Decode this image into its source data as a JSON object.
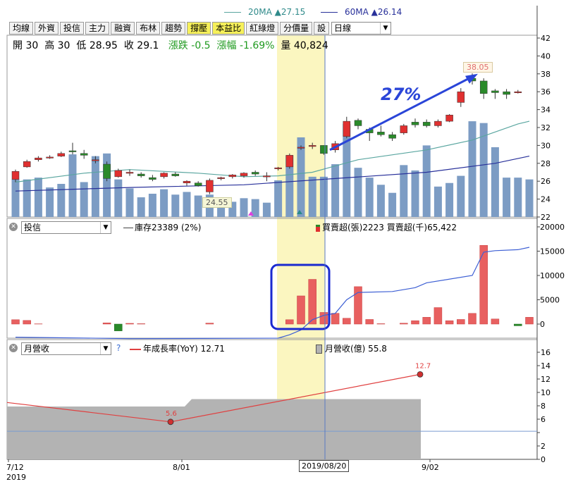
{
  "legend_top": {
    "ma20": "20MA ▲27.15",
    "ma60": "60MA ▲26.14"
  },
  "toolbar": {
    "buttons": [
      "均線",
      "外資",
      "投信",
      "主力",
      "融資",
      "布林",
      "趨勢",
      "撐壓",
      "本益比",
      "紅綠燈",
      "分價量",
      "設"
    ],
    "highlighted": [
      "撐壓",
      "本益比"
    ],
    "period": "日線"
  },
  "quote": {
    "open_label": "開",
    "open": "30",
    "high_label": "高",
    "high": "30",
    "low_label": "低",
    "low": "28.95",
    "close_label": "收",
    "close": "29.1",
    "chg_label": "漲跌",
    "chg": "-0.5",
    "pct_label": "漲幅",
    "pct": "-1.69%",
    "vol_label": "量",
    "vol": "40,824"
  },
  "annotations": {
    "pct": "27%",
    "high_label": "38.05",
    "low_label": "24.55",
    "date_marker": "2019/08/20"
  },
  "panel2": {
    "selector": "投信",
    "legend_inventory": "庫存23389 (2%)",
    "legend_net": "買賣超(張)2223 買賣超(千)65,422"
  },
  "panel3": {
    "selector": "月營收",
    "help": "?",
    "legend_yoy": "年成長率(YoY) 12.71",
    "legend_rev": "月營收(億) 55.8"
  },
  "x_axis": {
    "labels": [
      "7/12",
      "8/01",
      "9/02"
    ],
    "year": "2019"
  },
  "colors": {
    "up": "#e03030",
    "down": "#2a8a2a",
    "vol": "#7c9cc4",
    "ma20": "#5aa6a0",
    "ma60": "#28309a",
    "netbar": "#e86060",
    "inventory": "#3d5fd4",
    "yoy": "#e04040",
    "rev": "#b3b3b3",
    "highlight": "#fbf6c0"
  },
  "chart_data": [
    {
      "type": "candlestick",
      "title": "",
      "ylim": [
        22,
        42
      ],
      "yticks": [
        22,
        24,
        26,
        28,
        30,
        32,
        34,
        36,
        38,
        40,
        42
      ],
      "candles": [
        {
          "o": 26.2,
          "h": 27.3,
          "l": 25.9,
          "c": 27.1
        },
        {
          "o": 27.6,
          "h": 28.4,
          "l": 27.5,
          "c": 28.2
        },
        {
          "o": 28.4,
          "h": 28.8,
          "l": 28.2,
          "c": 28.6
        },
        {
          "o": 28.7,
          "h": 28.9,
          "l": 28.5,
          "c": 28.7
        },
        {
          "o": 28.8,
          "h": 29.3,
          "l": 28.7,
          "c": 29.1
        },
        {
          "o": 29.4,
          "h": 30.3,
          "l": 29.0,
          "c": 29.3
        },
        {
          "o": 29.1,
          "h": 29.5,
          "l": 28.5,
          "c": 28.9
        },
        {
          "o": 28.4,
          "h": 28.8,
          "l": 28.0,
          "c": 28.4
        },
        {
          "o": 27.9,
          "h": 28.2,
          "l": 26.0,
          "c": 26.3
        },
        {
          "o": 26.5,
          "h": 27.4,
          "l": 26.4,
          "c": 27.2
        },
        {
          "o": 26.9,
          "h": 27.3,
          "l": 26.6,
          "c": 27.0
        },
        {
          "o": 26.8,
          "h": 27.0,
          "l": 26.4,
          "c": 26.6
        },
        {
          "o": 26.4,
          "h": 26.7,
          "l": 26.0,
          "c": 26.2
        },
        {
          "o": 26.5,
          "h": 27.0,
          "l": 26.3,
          "c": 26.9
        },
        {
          "o": 26.8,
          "h": 27.0,
          "l": 26.5,
          "c": 26.6
        },
        {
          "o": 25.8,
          "h": 26.1,
          "l": 25.5,
          "c": 26.0
        },
        {
          "o": 25.8,
          "h": 26.0,
          "l": 25.4,
          "c": 25.5
        },
        {
          "o": 24.8,
          "h": 26.3,
          "l": 24.55,
          "c": 26.1
        },
        {
          "o": 26.3,
          "h": 26.5,
          "l": 26.1,
          "c": 26.4
        },
        {
          "o": 26.5,
          "h": 26.8,
          "l": 26.3,
          "c": 26.7
        },
        {
          "o": 26.6,
          "h": 27.0,
          "l": 26.4,
          "c": 26.9
        },
        {
          "o": 27.0,
          "h": 27.2,
          "l": 26.6,
          "c": 26.8
        },
        {
          "o": 26.5,
          "h": 27.0,
          "l": 26.0,
          "c": 26.6
        },
        {
          "o": 27.4,
          "h": 27.6,
          "l": 27.2,
          "c": 27.5
        },
        {
          "o": 27.6,
          "h": 29.1,
          "l": 27.4,
          "c": 28.9
        },
        {
          "o": 29.7,
          "h": 30.0,
          "l": 29.5,
          "c": 29.8
        },
        {
          "o": 30.0,
          "h": 30.3,
          "l": 29.6,
          "c": 30.0
        },
        {
          "o": 30.0,
          "h": 30.0,
          "l": 28.95,
          "c": 29.1
        },
        {
          "o": 29.5,
          "h": 30.5,
          "l": 29.2,
          "c": 30.2
        },
        {
          "o": 31.0,
          "h": 33.2,
          "l": 30.8,
          "c": 32.7
        },
        {
          "o": 32.8,
          "h": 33.0,
          "l": 31.8,
          "c": 32.2
        },
        {
          "o": 31.8,
          "h": 32.0,
          "l": 30.5,
          "c": 31.4
        },
        {
          "o": 31.5,
          "h": 32.2,
          "l": 31.0,
          "c": 31.2
        },
        {
          "o": 31.2,
          "h": 31.5,
          "l": 30.5,
          "c": 30.8
        },
        {
          "o": 31.4,
          "h": 32.4,
          "l": 31.2,
          "c": 32.2
        },
        {
          "o": 32.6,
          "h": 33.0,
          "l": 32.0,
          "c": 32.3
        },
        {
          "o": 32.6,
          "h": 32.9,
          "l": 32.0,
          "c": 32.2
        },
        {
          "o": 32.2,
          "h": 32.9,
          "l": 32.0,
          "c": 32.7
        },
        {
          "o": 32.7,
          "h": 33.5,
          "l": 32.6,
          "c": 33.4
        },
        {
          "o": 34.8,
          "h": 36.4,
          "l": 34.3,
          "c": 36.0
        },
        {
          "o": 37.5,
          "h": 38.05,
          "l": 36.8,
          "c": 37.2
        },
        {
          "o": 37.2,
          "h": 37.5,
          "l": 35.2,
          "c": 35.8
        },
        {
          "o": 36.1,
          "h": 36.3,
          "l": 35.2,
          "c": 35.9
        },
        {
          "o": 36.0,
          "h": 36.3,
          "l": 35.2,
          "c": 35.7
        },
        {
          "o": 35.9,
          "h": 36.2,
          "l": 35.8,
          "c": 36.0
        }
      ],
      "volume": [
        4.2,
        4.2,
        4.4,
        3.3,
        3.7,
        7.0,
        3.9,
        6.8,
        7.1,
        4.2,
        3.2,
        2.2,
        2.6,
        3.1,
        2.5,
        2.8,
        2.4,
        2.5,
        2.2,
        1.7,
        2.1,
        2.0,
        1.6,
        4.1,
        6.9,
        8.9,
        4.5,
        4.5,
        5.9,
        10.4,
        5.5,
        4.4,
        3.6,
        2.7,
        5.8,
        5.2,
        8.0,
        3.4,
        3.8,
        4.6,
        10.7,
        10.5,
        7.8,
        4.4,
        4.4,
        4.2
      ],
      "volume_scale_note": "volume bars are drawn relative to the price axis baseline",
      "ma20": [
        [
          0,
          25.9
        ],
        [
          6,
          26.9
        ],
        [
          10,
          27.3
        ],
        [
          16,
          26.9
        ],
        [
          20,
          26.5
        ],
        [
          23,
          26.6
        ],
        [
          26,
          27.0
        ],
        [
          28,
          27.7
        ],
        [
          30,
          28.4
        ],
        [
          36,
          29.5
        ],
        [
          40,
          30.6
        ],
        [
          44,
          32.4
        ],
        [
          45,
          32.7
        ]
      ],
      "ma60": [
        [
          0,
          24.9
        ],
        [
          10,
          25.3
        ],
        [
          20,
          25.6
        ],
        [
          28,
          26.3
        ],
        [
          36,
          27.0
        ],
        [
          42,
          28.0
        ],
        [
          45,
          28.8
        ]
      ],
      "series": [
        {
          "name": "20MA"
        },
        {
          "name": "60MA"
        }
      ]
    },
    {
      "type": "bar",
      "ylim": [
        -2000,
        20000
      ],
      "yticks": [
        0,
        5000,
        10000,
        15000,
        20000
      ],
      "net_buy": [
        900,
        750,
        50,
        0,
        0,
        0,
        0,
        0,
        250,
        -1400,
        150,
        80,
        0,
        0,
        0,
        0,
        0,
        200,
        0,
        0,
        0,
        0,
        0,
        0,
        900,
        5800,
        9200,
        2400,
        2223,
        1200,
        7700,
        950,
        80,
        0,
        180,
        700,
        1400,
        3400,
        700,
        950,
        2200,
        16200,
        1050,
        0,
        -350,
        1400,
        800
      ],
      "series": [
        {
          "name": "買賣超(張)"
        },
        {
          "name": "庫存"
        }
      ],
      "inventory": [
        [
          0,
          -2700
        ],
        [
          10,
          -3000
        ],
        [
          23,
          -2900
        ],
        [
          24,
          -2200
        ],
        [
          25,
          -1200
        ],
        [
          26,
          900
        ],
        [
          27,
          1800
        ],
        [
          28,
          2200
        ],
        [
          29,
          5000
        ],
        [
          30,
          6500
        ],
        [
          33,
          6700
        ],
        [
          35,
          7500
        ],
        [
          36,
          8500
        ],
        [
          40,
          10000
        ],
        [
          41,
          14800
        ],
        [
          42,
          15100
        ],
        [
          44,
          15300
        ],
        [
          45,
          15800
        ]
      ]
    },
    {
      "type": "line",
      "ylim": [
        0,
        16
      ],
      "yticks": [
        0,
        2,
        4,
        6,
        8,
        10,
        12,
        14,
        16
      ],
      "yoy": [
        {
          "x": "7/01",
          "y": 8.5
        },
        {
          "x": "8/01",
          "y": 5.6
        },
        {
          "x": "9/01",
          "y": 12.7
        }
      ],
      "revenue": [
        {
          "x": "7",
          "y": 7.9
        },
        {
          "x": "8",
          "y": 9.0
        }
      ],
      "series": [
        {
          "name": "年成長率(YoY)"
        },
        {
          "name": "月營收(億)"
        }
      ],
      "value_labels": [
        "5.6",
        "12.7"
      ]
    }
  ]
}
